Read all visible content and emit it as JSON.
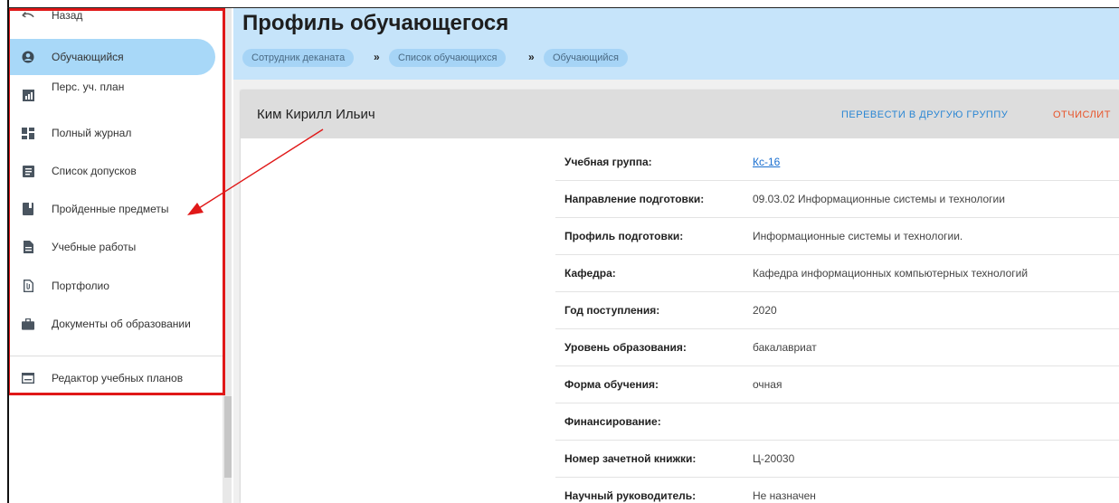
{
  "sidebar": {
    "items": [
      {
        "label": "Назад",
        "icon": "back-arrow-icon"
      },
      {
        "label": "Обучающийся",
        "icon": "user-circle-icon",
        "active": true
      },
      {
        "label": "Перс. уч. план",
        "icon": "chart-icon"
      },
      {
        "label": "Полный журнал",
        "icon": "dashboard-icon"
      },
      {
        "label": "Список допусков",
        "icon": "list-icon"
      },
      {
        "label": "Пройденные предметы",
        "icon": "book-icon"
      },
      {
        "label": "Учебные работы",
        "icon": "document-icon"
      },
      {
        "label": "Портфолио",
        "icon": "attachment-icon"
      },
      {
        "label": "Документы об образовании",
        "icon": "briefcase-icon"
      },
      {
        "label": "Редактор учебных планов",
        "icon": "keyboard-icon"
      }
    ]
  },
  "header": {
    "title": "Профиль обучающегося",
    "breadcrumbs": [
      "Сотрудник деканата",
      "Список обучающихся",
      "Обучающийся"
    ],
    "separator": "»"
  },
  "card": {
    "student_name": "Ким Кирилл Ильич",
    "actions": {
      "transfer": "ПЕРЕВЕСТИ В ДРУГУЮ ГРУППУ",
      "expel": "ОТЧИСЛИТ"
    },
    "fields": [
      {
        "label": "Учебная группа:",
        "value": "Кс-16",
        "link": true
      },
      {
        "label": "Направление подготовки:",
        "value": "09.03.02 Информационные системы и технологии"
      },
      {
        "label": "Профиль подготовки:",
        "value": "Информационные системы и технологии."
      },
      {
        "label": "Кафедра:",
        "value": "Кафедра информационных компьютерных технологий"
      },
      {
        "label": "Год поступления:",
        "value": "2020"
      },
      {
        "label": "Уровень образования:",
        "value": "бакалавриат"
      },
      {
        "label": "Форма обучения:",
        "value": "очная"
      },
      {
        "label": "Финансирование:",
        "value": ""
      },
      {
        "label": "Номер зачетной книжки:",
        "value": "Ц-20030"
      },
      {
        "label": "Научный руководитель:",
        "value": "Не назначен"
      }
    ]
  },
  "colors": {
    "header_bg": "#c6e4fa",
    "active_item": "#a8d8f8",
    "transfer_action": "#2a86d4",
    "expel_action": "#e8542a",
    "highlight": "#e01818"
  }
}
